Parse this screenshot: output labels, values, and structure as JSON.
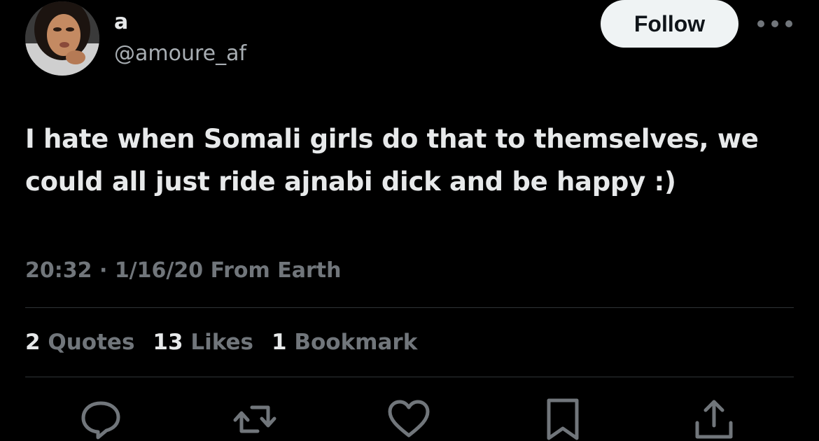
{
  "author": {
    "display_name": "a",
    "handle": "@amoure_af"
  },
  "follow_label": "Follow",
  "tweet": {
    "text": "I hate when Somali girls do that to themselves, we could all just ride ajnabi dick and be happy :)",
    "time": "20:32",
    "separator": "·",
    "date": "1/16/20",
    "source": "From Earth"
  },
  "stats": {
    "quotes_count": "2",
    "quotes_label": "Quotes",
    "likes_count": "13",
    "likes_label": "Likes",
    "bookmarks_count": "1",
    "bookmarks_label": "Bookmark"
  },
  "icons": {
    "reply": "reply-icon",
    "retweet": "retweet-icon",
    "like": "heart-icon",
    "bookmark": "bookmark-icon",
    "share": "share-icon",
    "more": "more-icon"
  },
  "colors": {
    "background": "#000000",
    "text_primary": "#e7e9ea",
    "text_secondary": "#71767b",
    "follow_bg": "#eff3f4",
    "divider": "#2f3336"
  }
}
